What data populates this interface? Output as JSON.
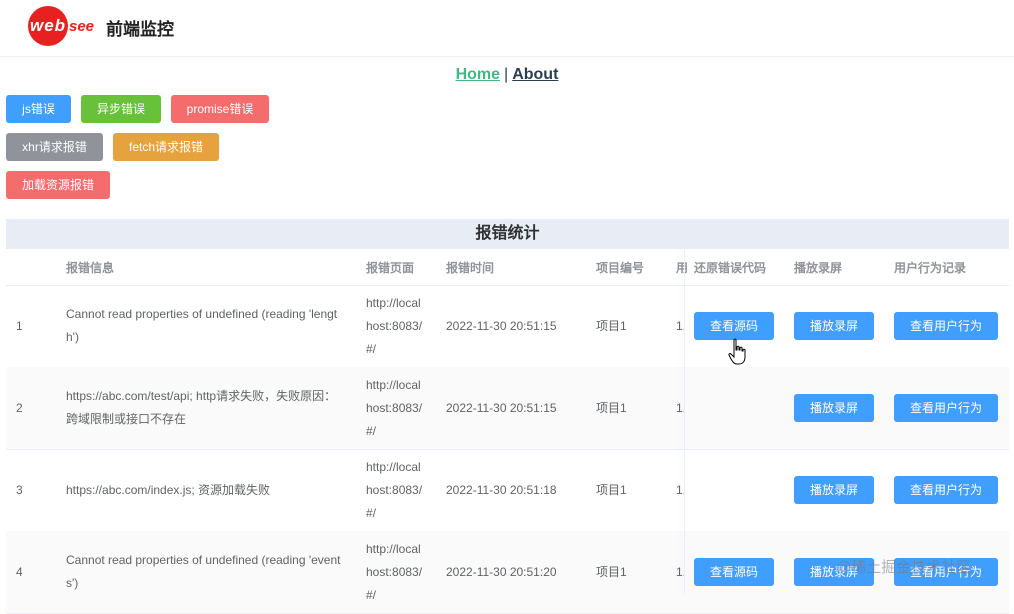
{
  "header": {
    "logo_part1": "web",
    "logo_part2": "see",
    "title": "前端监控"
  },
  "nav": {
    "home": "Home",
    "separator": "|",
    "about": "About"
  },
  "trigger_buttons": [
    {
      "label": "js错误",
      "color": "#409eff"
    },
    {
      "label": "异步错误",
      "color": "#67c23a"
    },
    {
      "label": "promise错误",
      "color": "#f56c6c"
    },
    {
      "label": "xhr请求报错",
      "color": "#909399"
    },
    {
      "label": "fetch请求报错",
      "color": "#e6a23c"
    },
    {
      "label": "加载资源报错",
      "color": "#f56c6c"
    }
  ],
  "table": {
    "title": "报错统计",
    "columns": [
      "报错信息",
      "报错页面",
      "报错时间",
      "项目编号",
      "用",
      "还原错误代码",
      "播放录屏",
      "用户行为记录"
    ],
    "rows": [
      {
        "index": "1",
        "message_lines": [
          "Cannot read properties of undefined (reading 'lengt",
          "h')"
        ],
        "page_lines": [
          "http://local",
          "host:8083/",
          "#/"
        ],
        "time": "2022-11-30 20:51:15",
        "project": "项目1",
        "user": "1.",
        "show_source": true
      },
      {
        "index": "2",
        "message_lines": [
          "https://abc.com/test/api; http请求失败，失败原因：",
          "跨域限制或接口不存在"
        ],
        "page_lines": [
          "http://local",
          "host:8083/",
          "#/"
        ],
        "time": "2022-11-30 20:51:15",
        "project": "项目1",
        "user": "1.",
        "show_source": false
      },
      {
        "index": "3",
        "message_lines": [
          "https://abc.com/index.js; 资源加载失败"
        ],
        "page_lines": [
          "http://local",
          "host:8083/",
          "#/"
        ],
        "time": "2022-11-30 20:51:18",
        "project": "项目1",
        "user": "1.",
        "show_source": false
      },
      {
        "index": "4",
        "message_lines": [
          "Cannot read properties of undefined (reading 'event",
          "s')"
        ],
        "page_lines": [
          "http://local",
          "host:8083/",
          "#/"
        ],
        "time": "2022-11-30 20:51:20",
        "project": "项目1",
        "user": "1.",
        "show_source": true
      }
    ],
    "actions": {
      "source": "查看源码",
      "replay": "播放录屏",
      "behavior": "查看用户行为"
    }
  },
  "watermark": "@稀土掘金技术社区"
}
